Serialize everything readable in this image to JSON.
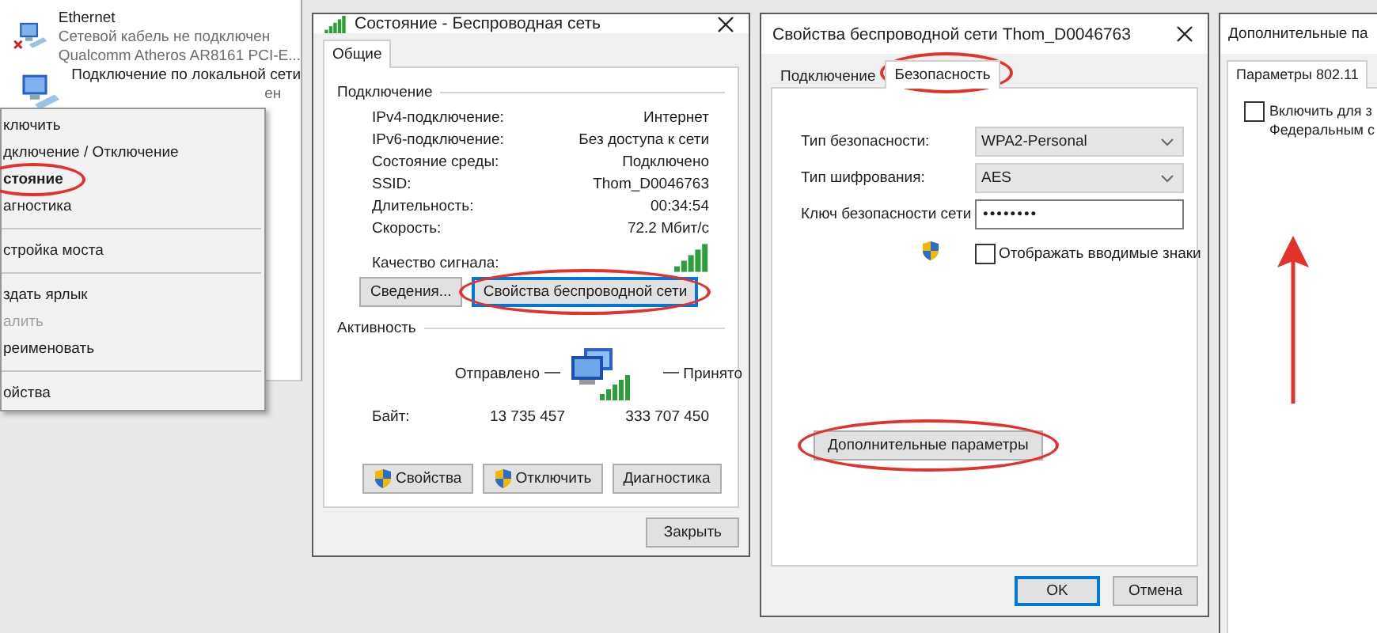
{
  "explorer": {
    "items": [
      {
        "name": "Ethernet",
        "status": "Сетевой кабель не подключен",
        "device": "Qualcomm Atheros AR8161 PCI-E...",
        "disconnected": true
      },
      {
        "name": "Подключение по локальной сети",
        "status": "ен",
        "disconnected": false
      }
    ]
  },
  "context_menu": {
    "items": [
      {
        "kind": "item",
        "label": "ключить",
        "bold": false,
        "disabled": false,
        "circled": false
      },
      {
        "kind": "item",
        "label": "дключение / Отключение",
        "bold": false,
        "disabled": false,
        "circled": false
      },
      {
        "kind": "item",
        "label": "стояние",
        "bold": true,
        "disabled": false,
        "circled": true
      },
      {
        "kind": "item",
        "label": "агностика",
        "bold": false,
        "disabled": false,
        "circled": false
      },
      {
        "kind": "separator"
      },
      {
        "kind": "item",
        "label": "стройка моста",
        "bold": false,
        "disabled": false,
        "circled": false
      },
      {
        "kind": "separator"
      },
      {
        "kind": "item",
        "label": "здать ярлык",
        "bold": false,
        "disabled": false,
        "circled": false
      },
      {
        "kind": "item",
        "label": "алить",
        "bold": false,
        "disabled": true,
        "circled": false
      },
      {
        "kind": "item",
        "label": "реименовать",
        "bold": false,
        "disabled": false,
        "circled": false
      },
      {
        "kind": "separator"
      },
      {
        "kind": "item",
        "label": "ойства",
        "bold": false,
        "disabled": false,
        "circled": false
      }
    ]
  },
  "status_window": {
    "title": "Состояние - Беспроводная сеть",
    "tabs": [
      {
        "label": "Общие",
        "selected": true
      }
    ],
    "connection": {
      "heading": "Подключение",
      "rows": [
        {
          "label": "IPv4-подключение:",
          "value": "Интернет"
        },
        {
          "label": "IPv6-подключение:",
          "value": "Без доступа к сети"
        },
        {
          "label": "Состояние среды:",
          "value": "Подключено"
        },
        {
          "label": "SSID:",
          "value": "Thom_D0046763"
        },
        {
          "label": "Длительность:",
          "value": "00:34:54"
        },
        {
          "label": "Скорость:",
          "value": "72.2 Мбит/с"
        }
      ],
      "signal_label": "Качество сигнала:",
      "buttons": [
        {
          "label": "Сведения...",
          "focused": false,
          "circled": false
        },
        {
          "label": "Свойства беспроводной сети",
          "focused": true,
          "circled": true
        }
      ]
    },
    "activity": {
      "heading": "Активность",
      "sent_label": "Отправлено",
      "received_label": "Принято",
      "bytes_label": "Байт:",
      "sent": "13 735 457",
      "received": "333 707 450"
    },
    "buttons": [
      {
        "label": "Свойства",
        "shield": true
      },
      {
        "label": "Отключить",
        "shield": true
      },
      {
        "label": "Диагностика",
        "shield": false
      }
    ],
    "close_button": "Закрыть"
  },
  "properties_window": {
    "title": "Свойства беспроводной сети Thom_D0046763",
    "tabs": [
      {
        "label": "Подключение",
        "selected": false,
        "circled": false
      },
      {
        "label": "Безопасность",
        "selected": true,
        "circled": true
      }
    ],
    "fields": [
      {
        "kind": "dropdown",
        "label": "Тип безопасности:",
        "value": "WPA2-Personal"
      },
      {
        "kind": "dropdown",
        "label": "Тип шифрования:",
        "value": "AES"
      },
      {
        "kind": "password",
        "label": "Ключ безопасности сети",
        "value": "••••••••"
      }
    ],
    "show_chars": {
      "label": "Отображать вводимые знаки",
      "checked": false
    },
    "advanced_button": {
      "label": "Дополнительные параметры",
      "circled": true
    },
    "buttons": [
      {
        "label": "OK",
        "default": true
      },
      {
        "label": "Отмена",
        "default": false
      }
    ]
  },
  "advanced_window": {
    "title": "Дополнительные па",
    "tabs": [
      {
        "label": "Параметры 802.11",
        "selected": true
      }
    ],
    "checkbox": {
      "label_lines": [
        "Включить для з",
        "Федеральным с"
      ],
      "checked": false
    },
    "annotation_arrow": true
  }
}
